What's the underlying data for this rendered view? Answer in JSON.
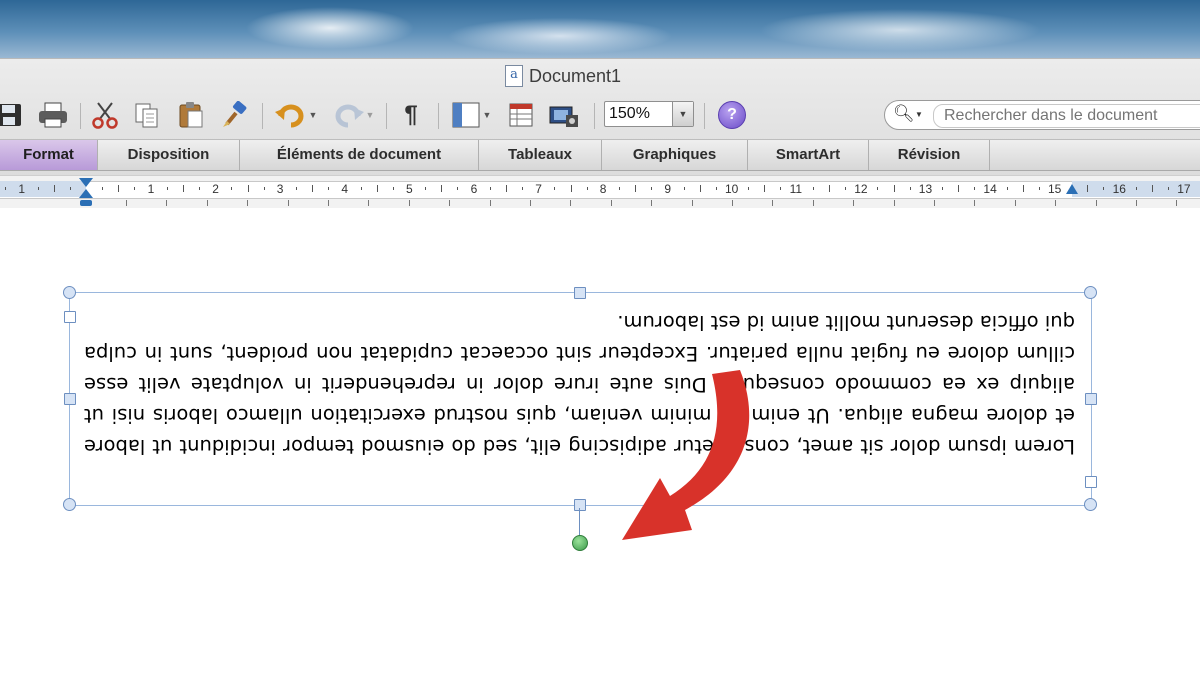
{
  "window": {
    "title": "Document1"
  },
  "toolbar": {
    "zoom_value": "150%",
    "help_label": "?",
    "paragraph_glyph": "¶",
    "search_placeholder": "Rechercher dans le document"
  },
  "ribbon": {
    "tabs": [
      {
        "label": "Format",
        "active": true
      },
      {
        "label": "Disposition"
      },
      {
        "label": "Éléments de document"
      },
      {
        "label": "Tableaux"
      },
      {
        "label": "Graphiques"
      },
      {
        "label": "SmartArt"
      },
      {
        "label": "Révision"
      }
    ]
  },
  "ruler": {
    "numbers": [
      "1",
      "1",
      "2",
      "3",
      "4",
      "5",
      "6",
      "7",
      "8",
      "9",
      "10",
      "11",
      "12",
      "13",
      "14",
      "15",
      "16",
      "17"
    ]
  },
  "document": {
    "textbox_text": "Lorem ipsum dolor sit amet, consectetur adipiscing elit, sed do eiusmod tempor incididunt ut labore et dolore magna aliqua. Ut enim ad minim veniam, quis nostrud exercitation ullamco laboris nisi ut aliquip ex ea commodo consequat. Duis aute irure dolor in reprehenderit in voluptate velit esse cillum dolore eu fugiat nulla pariatur. Excepteur sint occaecat cupidatat non proident, sunt in culpa qui officia deserunt mollit anim id est laborum.",
    "rotation_degrees": 180
  },
  "colors": {
    "active_tab": "#c3a8e0",
    "selection_border": "#9ab7dd",
    "rotate_handle": "#3c9a4a",
    "annotation_arrow": "#d8322a"
  }
}
